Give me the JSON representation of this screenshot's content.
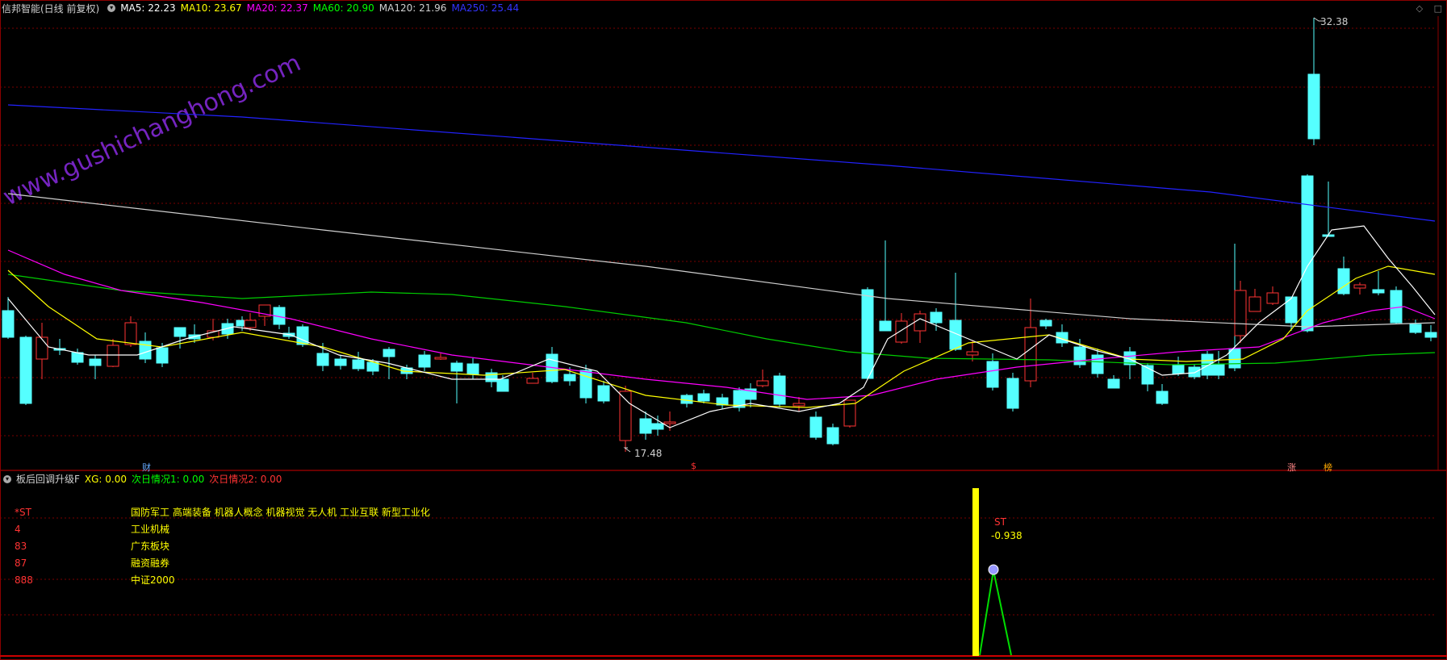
{
  "header": {
    "title": "信邦智能(日线 前复权)",
    "ma": [
      {
        "label": "MA5: 22.23",
        "color": "#ffffff"
      },
      {
        "label": "MA10: 23.67",
        "color": "#ffff00"
      },
      {
        "label": "MA20: 22.37",
        "color": "#ff00ff"
      },
      {
        "label": "MA60: 20.90",
        "color": "#00ff00"
      },
      {
        "label": "MA120: 21.96",
        "color": "#d0d0d0"
      },
      {
        "label": "MA250: 25.44",
        "color": "#3333ff"
      }
    ]
  },
  "top_icons": [
    "◇",
    "□"
  ],
  "watermark": "www.gushichanghong.com",
  "chart_data": {
    "type": "candlestick",
    "high_label": "32.38",
    "low_label": "17.48",
    "markers": [
      {
        "label": "财",
        "color": "#66aaff"
      },
      {
        "label": "$",
        "color": "#ff3333"
      },
      {
        "label": "涨",
        "color": "#ff8888"
      },
      {
        "label": "榜",
        "color": "#ffaa00"
      }
    ]
  },
  "indicator": {
    "name": "板后回调升级F",
    "xg": "XG: 0.00",
    "next1": "次日情况1: 0.00",
    "next2": "次日情况2: 0.00",
    "rows": [
      {
        "code": "*ST",
        "desc": "国防军工 高端装备 机器人概念 机器视觉 无人机 工业互联 新型工业化"
      },
      {
        "code": "4",
        "desc": "工业机械"
      },
      {
        "code": "83",
        "desc": "广东板块"
      },
      {
        "code": "87",
        "desc": "融资融券"
      },
      {
        "code": "888",
        "desc": "中证2000"
      }
    ],
    "signal_label": "ST",
    "signal_value": "-0.938"
  }
}
